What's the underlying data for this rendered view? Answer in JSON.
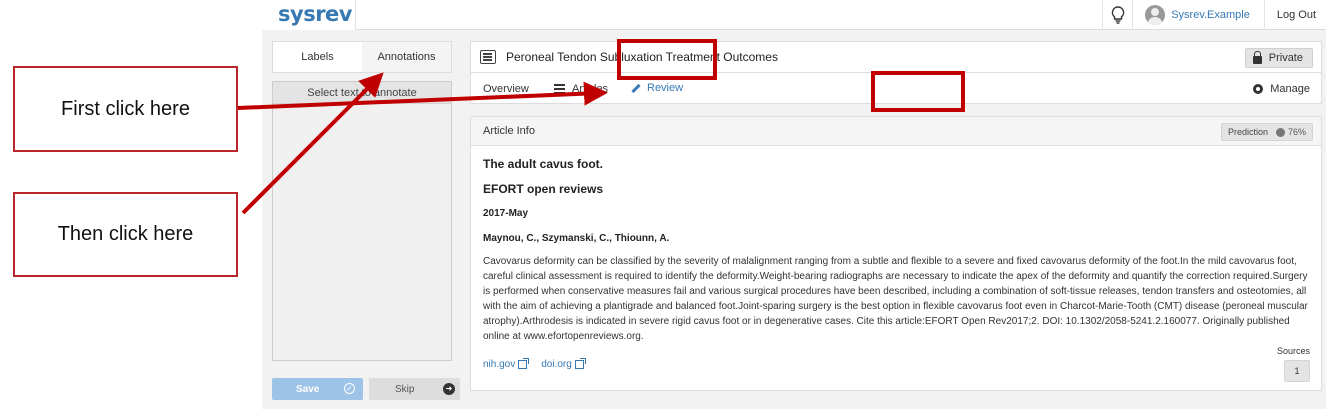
{
  "callouts": {
    "first": "First click here",
    "then": "Then click here"
  },
  "header": {
    "logo": "sysrev",
    "user_name": "Sysrev.Example",
    "logout": "Log Out"
  },
  "left_panel": {
    "tabs": [
      {
        "label": "Labels"
      },
      {
        "label": "Annotations"
      }
    ],
    "annotate_hint": "Select text to annotate",
    "save_label": "Save",
    "skip_label": "Skip"
  },
  "project": {
    "title": "Peroneal Tendon Subluxation Treatment Outcomes",
    "visibility": "Private",
    "nav": {
      "overview": "Overview",
      "articles": "Articles",
      "review": "Review",
      "manage": "Manage"
    }
  },
  "article": {
    "section_title": "Article Info",
    "prediction_label": "Prediction",
    "prediction_value": "76%",
    "title": "The adult cavus foot.",
    "journal": "EFORT open reviews",
    "date": "2017-May",
    "authors": "Maynou, C., Szymanski, C., Thiounn, A.",
    "abstract": "Cavovarus deformity can be classified by the severity of malalignment ranging from a subtle and flexible to a severe and fixed cavovarus deformity of the foot.In the mild cavovarus foot, careful clinical assessment is required to identify the deformity.Weight-bearing radiographs are necessary to indicate the apex of the deformity and quantify the correction required.Surgery is performed when conservative measures fail and various surgical procedures have been described, including a combination of soft-tissue releases, tendon transfers and osteotomies, all with the aim of achieving a plantigrade and balanced foot.Joint-sparing surgery is the best option in flexible cavovarus foot even in Charcot-Marie-Tooth (CMT) disease (peroneal muscular atrophy).Arthrodesis is indicated in severe rigid cavus foot or in degenerative cases. Cite this article:EFORT Open Rev2017;2. DOI: 10.1302/2058-5241.2.160077. Originally published online at www.efortopenreviews.org.",
    "links": [
      {
        "label": "nih.gov"
      },
      {
        "label": "doi.org"
      }
    ],
    "sources_label": "Sources",
    "sources_count": "1"
  },
  "colors": {
    "highlight": "#c00000",
    "brand": "#3679b3"
  }
}
